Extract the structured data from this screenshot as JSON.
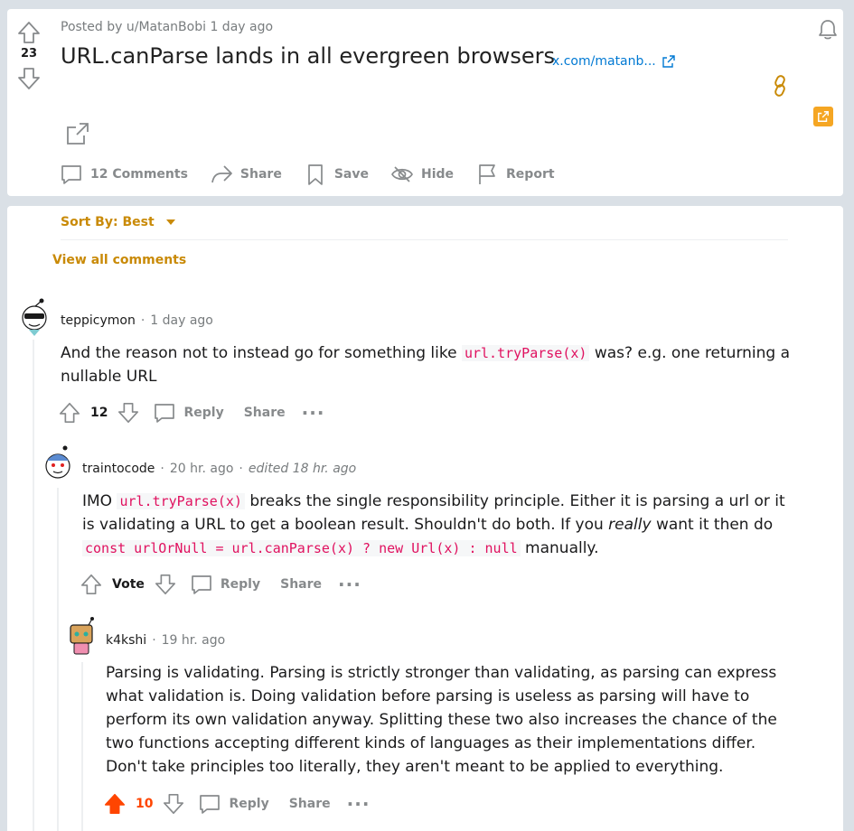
{
  "post": {
    "score": "23",
    "meta": "Posted by u/MatanBobi 1 day ago",
    "title": "URL.canParse lands in all evergreen browsers",
    "link": "x.com/matanb...",
    "actions": {
      "comments": "12 Comments",
      "share": "Share",
      "save": "Save",
      "hide": "Hide",
      "report": "Report"
    }
  },
  "sort": {
    "label": "Sort By: Best"
  },
  "view_all": "View all comments",
  "comments": [
    {
      "user": "teppicymon",
      "time": "1 day ago",
      "edited": "",
      "body_parts": [
        "And the reason not to instead go for something like ",
        "url.tryParse(x)",
        " was? e.g. one returning a nullable URL"
      ],
      "score": "12",
      "reply": "Reply",
      "share": "Share"
    },
    {
      "user": "traintocode",
      "time": "20 hr. ago",
      "edited": "edited 18 hr. ago",
      "body_parts": [
        "IMO ",
        "url.tryParse(x)",
        " breaks the single responsibility principle. Either it is parsing a url or it is validating a URL to get a boolean result. Shouldn't do both. If you ",
        "really",
        " want it then do ",
        "const urlOrNull = url.canParse(x) ? new Url(x) : null",
        " manually."
      ],
      "score": "Vote",
      "reply": "Reply",
      "share": "Share"
    },
    {
      "user": "k4kshi",
      "time": "19 hr. ago",
      "edited": "",
      "body": "Parsing is validating. Parsing is strictly stronger than validating, as parsing can express what validation is. Doing validation before parsing is useless as parsing will have to perform its own validation anyway. Splitting these two also increases the chance of the two functions accepting different kinds of languages as their implementations differ. Don't take principles too literally, they aren't meant to be applied to everything.",
      "score": "10",
      "reply": "Reply",
      "share": "Share"
    }
  ],
  "colors": {
    "accent": "#c98a07",
    "upvote": "#ff4500",
    "link": "#0079d3",
    "code": "#e0115f"
  }
}
